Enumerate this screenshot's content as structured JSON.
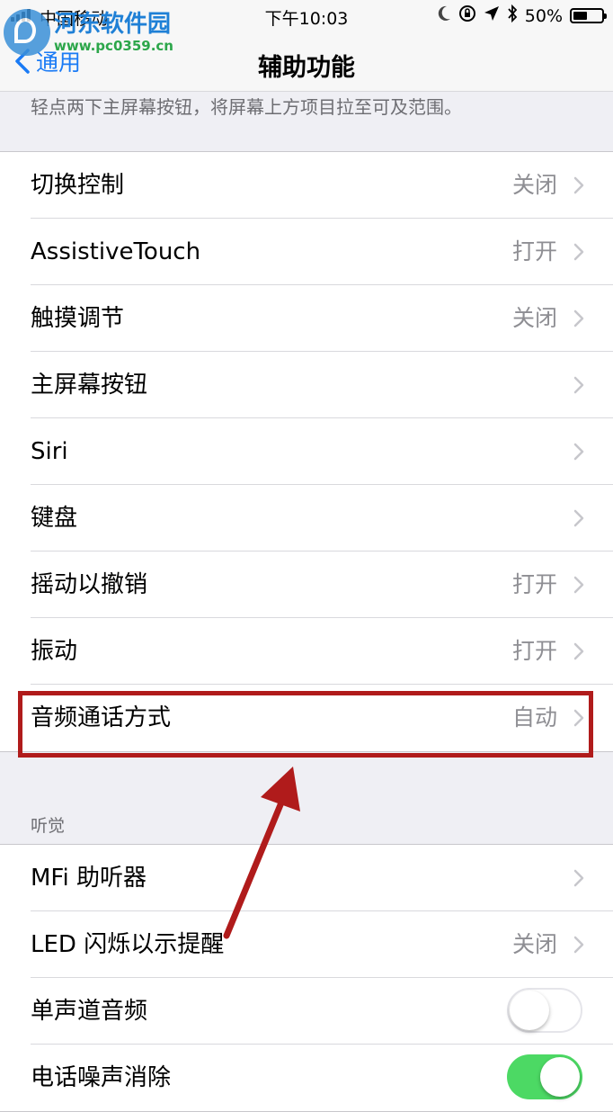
{
  "status_bar": {
    "carrier": "中国移动",
    "time": "下午10:03",
    "battery_percent": "50%",
    "battery_level": 0.5
  },
  "watermark": {
    "site_name": "河东软件园",
    "url": "www.pc0359.cn"
  },
  "nav": {
    "back_label": "通用",
    "title": "辅助功能"
  },
  "reachability_footer": "轻点两下主屏幕按钮，将屏幕上方项目拉至可及范围。",
  "interaction_rows": [
    {
      "label": "切换控制",
      "value": "关闭"
    },
    {
      "label": "AssistiveTouch",
      "value": "打开"
    },
    {
      "label": "触摸调节",
      "value": "关闭"
    },
    {
      "label": "主屏幕按钮",
      "value": ""
    },
    {
      "label": "Siri",
      "value": ""
    },
    {
      "label": "键盘",
      "value": ""
    },
    {
      "label": "摇动以撤销",
      "value": "打开"
    },
    {
      "label": "振动",
      "value": "打开"
    },
    {
      "label": "音频通话方式",
      "value": "自动"
    }
  ],
  "hearing_section": {
    "header": "听觉",
    "rows": [
      {
        "label": "MFi 助听器",
        "value": ""
      },
      {
        "label": "LED 闪烁以示提醒",
        "value": "关闭"
      },
      {
        "label": "单声道音频",
        "toggle": false
      },
      {
        "label": "电话噪声消除",
        "toggle": true
      }
    ]
  },
  "colors": {
    "accent_blue": "#1a7bf5",
    "annotation_red": "#b01b1b",
    "toggle_green": "#4cd964",
    "background": "#efeff4"
  }
}
